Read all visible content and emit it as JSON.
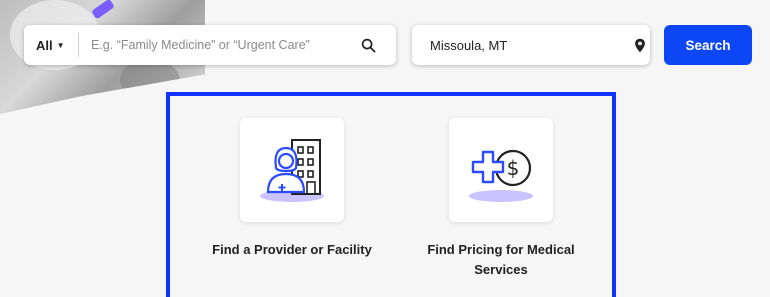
{
  "search": {
    "category": "All",
    "placeholder": "E.g. “Family Medicine” or “Urgent Care”",
    "value": ""
  },
  "location": {
    "value": "Missoula, MT"
  },
  "search_button": "Search",
  "options": [
    {
      "label": "Find a Provider or Facility",
      "icon": "provider-building-icon"
    },
    {
      "label": "Find Pricing for Medical Services",
      "icon": "medical-pricing-icon"
    }
  ],
  "colors": {
    "primary": "#0d47f5",
    "highlight_border": "#1133ff",
    "icon_blue": "#2a4bff",
    "icon_shadow": "#c9c3ff"
  }
}
